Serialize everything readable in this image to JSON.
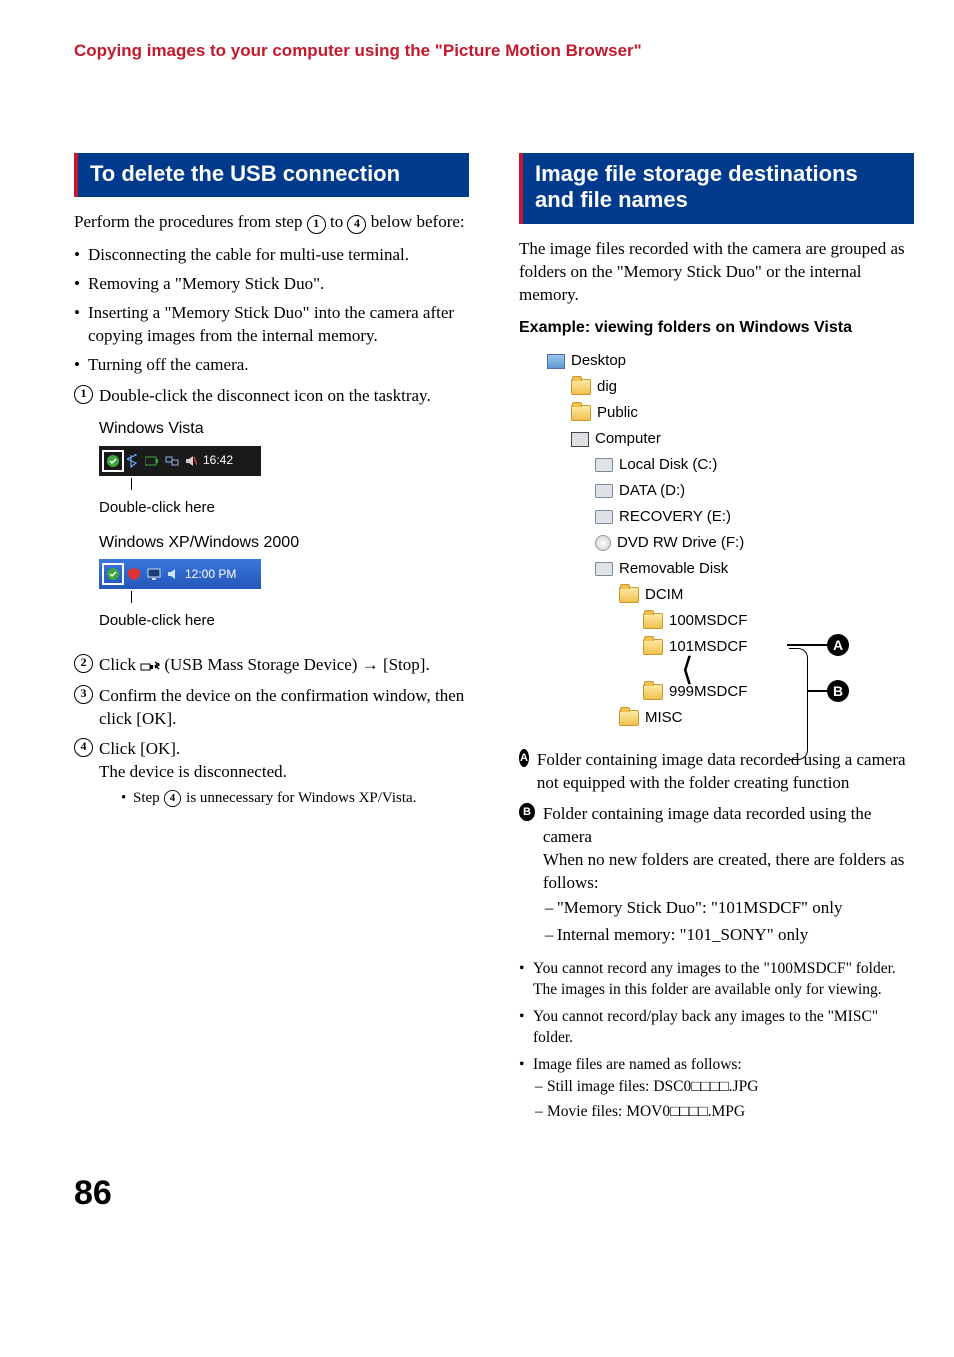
{
  "header": "Copying images to your computer using the \"Picture Motion Browser\"",
  "page_number": "86",
  "left": {
    "section_title": "To delete the USB connection",
    "intro_a": "Perform the procedures from step ",
    "intro_b": " to ",
    "intro_c": " below before:",
    "step_from": "1",
    "step_to": "4",
    "pre_bullets": [
      "Disconnecting the cable for multi-use terminal.",
      "Removing a \"Memory Stick Duo\".",
      "Inserting a \"Memory Stick Duo\" into the camera after copying images from the internal memory.",
      "Turning off the camera."
    ],
    "steps": [
      {
        "n": "1",
        "text": "Double-click the disconnect icon on the tasktray."
      },
      {
        "n": "2",
        "text_a": "Click ",
        "text_b": " (USB Mass Storage Device) → [Stop]."
      },
      {
        "n": "3",
        "text": "Confirm the device on the confirmation window, then click [OK]."
      },
      {
        "n": "4",
        "text": "Click [OK].",
        "after": "The device is disconnected.",
        "sub_a": "Step ",
        "sub_b": " is unnecessary for Windows XP/Vista.",
        "sub_n": "4"
      }
    ],
    "vista_label": "Windows Vista",
    "vista_time": "16:42",
    "xp_label": "Windows XP/Windows 2000",
    "xp_time": "12:00 PM",
    "double_click": "Double-click here"
  },
  "right": {
    "section_title": "Image file storage destinations and file names",
    "intro": "The image files recorded with the camera are grouped as folders on the \"Memory Stick Duo\" or the internal memory.",
    "example_head": "Example: viewing folders on Windows Vista",
    "tree": {
      "desktop": "Desktop",
      "user": "dig",
      "public": "Public",
      "computer": "Computer",
      "c": "Local Disk (C:)",
      "d": "DATA (D:)",
      "e": "RECOVERY (E:)",
      "f": "DVD RW Drive (F:)",
      "rem": "Removable Disk",
      "dcim": "DCIM",
      "f100": "100MSDCF",
      "f101": "101MSDCF",
      "f999": "999MSDCF",
      "misc": "MISC"
    },
    "callout_a": "A",
    "callout_b": "B",
    "desc": [
      {
        "mark": "A",
        "text": "Folder containing image data recorded using a camera not equipped with the folder creating function"
      },
      {
        "mark": "B",
        "text1": "Folder containing image data recorded using the camera",
        "text2": "When no new folders are created, there are folders as follows:",
        "dashes": [
          "\"Memory Stick Duo\": \"101MSDCF\" only",
          "Internal memory: \"101_SONY\" only"
        ]
      }
    ],
    "notes": [
      "You cannot record any images to the \"100MSDCF\" folder. The images in this folder are available only for viewing.",
      "You cannot record/play back any images to the \"MISC\" folder.",
      "Image files are named as follows:"
    ],
    "name_entries": [
      "Still image files: DSC0□□□□.JPG",
      "Movie files: MOV0□□□□.MPG"
    ]
  }
}
